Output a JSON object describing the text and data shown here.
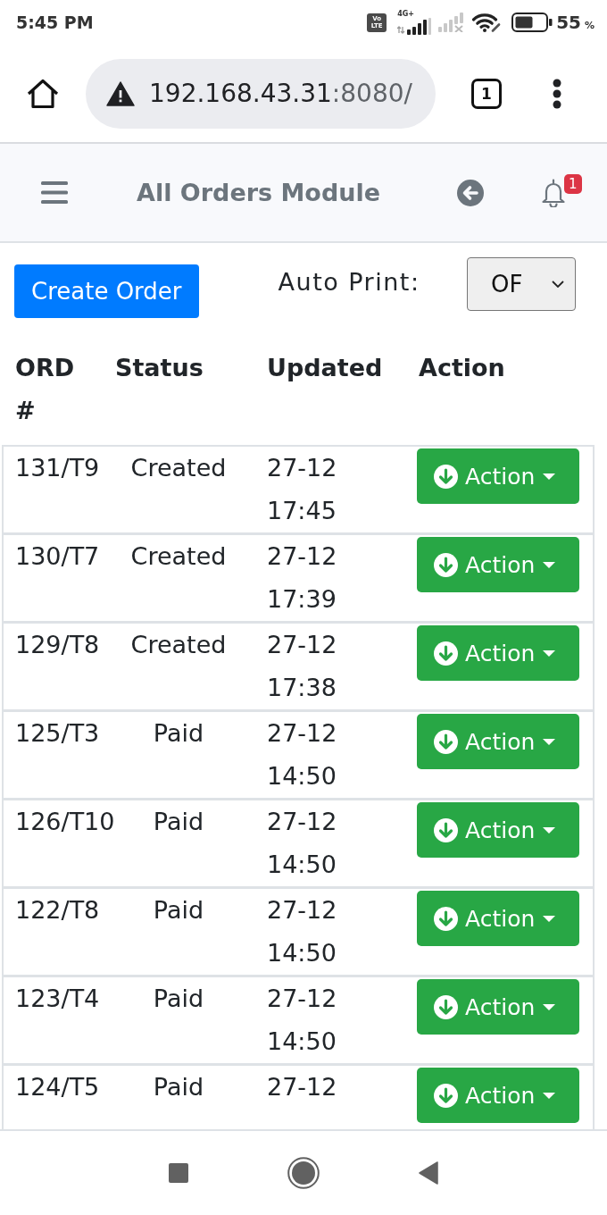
{
  "status_bar": {
    "time": "5:45 PM",
    "volte_badge": [
      "Vo",
      "LTE"
    ],
    "network_type": "4G+",
    "battery_percent": "55",
    "battery_unit": "%"
  },
  "browser": {
    "url_host": "192.168.43.31",
    "url_rest": ":8080/",
    "tab_count": "1"
  },
  "navbar": {
    "title": "All Orders Module",
    "notification_count": "1"
  },
  "toolbar": {
    "create_button": "Create Order",
    "auto_print_label": "Auto Print:",
    "auto_print_value": "OF"
  },
  "table": {
    "columns": [
      "ORD #",
      "Status",
      "Updated",
      "Action"
    ],
    "rows": [
      {
        "order": "131/T9",
        "status": "Created",
        "updated": "27-12 17:45",
        "action": "Action"
      },
      {
        "order": "130/T7",
        "status": "Created",
        "updated": "27-12 17:39",
        "action": "Action"
      },
      {
        "order": "129/T8",
        "status": "Created",
        "updated": "27-12 17:38",
        "action": "Action"
      },
      {
        "order": "125/T3",
        "status": "Paid",
        "updated": "27-12 14:50",
        "action": "Action"
      },
      {
        "order": "126/T10",
        "status": "Paid",
        "updated": "27-12 14:50",
        "action": "Action"
      },
      {
        "order": "122/T8",
        "status": "Paid",
        "updated": "27-12 14:50",
        "action": "Action"
      },
      {
        "order": "123/T4",
        "status": "Paid",
        "updated": "27-12 14:50",
        "action": "Action"
      },
      {
        "order": "124/T5",
        "status": "Paid",
        "updated": "27-12",
        "action": "Action"
      }
    ]
  }
}
